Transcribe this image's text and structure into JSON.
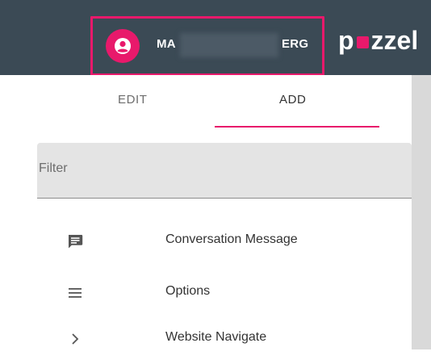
{
  "header": {
    "user_name_start": "MA",
    "user_name_end": "ERG",
    "logo_text_start": "p",
    "logo_text_end": "zzel"
  },
  "tabs": [
    {
      "label": "EDIT",
      "active": false
    },
    {
      "label": "ADD",
      "active": true
    }
  ],
  "filter": {
    "placeholder": "Filter",
    "value": ""
  },
  "items": [
    {
      "label": "Conversation Message",
      "icon": "chat-message-icon"
    },
    {
      "label": "Options",
      "icon": "menu-lines-icon"
    },
    {
      "label": "Website Navigate",
      "icon": "chevron-right-icon"
    }
  ],
  "colors": {
    "topbar": "#3b4a55",
    "accent": "#e8196b",
    "filter_bg": "#e4e4e4"
  }
}
